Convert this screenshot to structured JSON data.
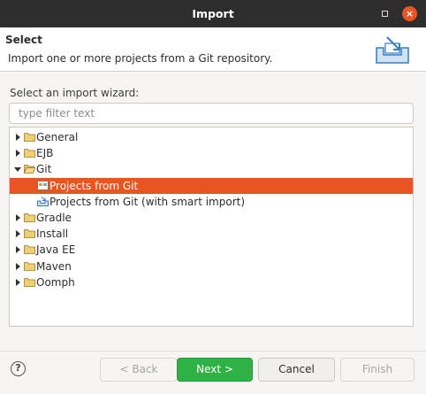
{
  "window": {
    "title": "Import",
    "maximize_icon": "maximize-icon",
    "close_icon": "close-icon",
    "close_glyph": "×"
  },
  "header": {
    "title": "Select",
    "description": "Import one or more projects from a Git repository.",
    "banner_icon": "import-banner-icon"
  },
  "wizard": {
    "label": "Select an import wizard:",
    "filter_placeholder": "type filter text",
    "filter_value": ""
  },
  "tree": {
    "items": [
      {
        "label": "General",
        "level": 0,
        "expanded": false,
        "icon": "folder-icon"
      },
      {
        "label": "EJB",
        "level": 0,
        "expanded": false,
        "icon": "folder-icon"
      },
      {
        "label": "Git",
        "level": 0,
        "expanded": true,
        "icon": "folder-open-icon"
      },
      {
        "label": "Projects from Git",
        "level": 1,
        "selected": true,
        "icon": "git-projects-icon"
      },
      {
        "label": "Projects from Git (with smart import)",
        "level": 1,
        "icon": "smart-import-icon"
      },
      {
        "label": "Gradle",
        "level": 0,
        "expanded": false,
        "icon": "folder-icon"
      },
      {
        "label": "Install",
        "level": 0,
        "expanded": false,
        "icon": "folder-icon"
      },
      {
        "label": "Java EE",
        "level": 0,
        "expanded": false,
        "icon": "folder-icon"
      },
      {
        "label": "Maven",
        "level": 0,
        "expanded": false,
        "icon": "folder-icon"
      },
      {
        "label": "Oomph",
        "level": 0,
        "expanded": false,
        "icon": "folder-icon"
      }
    ]
  },
  "footer": {
    "help_glyph": "?",
    "back_label": "< Back",
    "next_label": "Next >",
    "cancel_label": "Cancel",
    "finish_label": "Finish"
  },
  "colors": {
    "accent": "#e95420",
    "primary_button": "#2fb245",
    "titlebar": "#2d2d2d"
  }
}
